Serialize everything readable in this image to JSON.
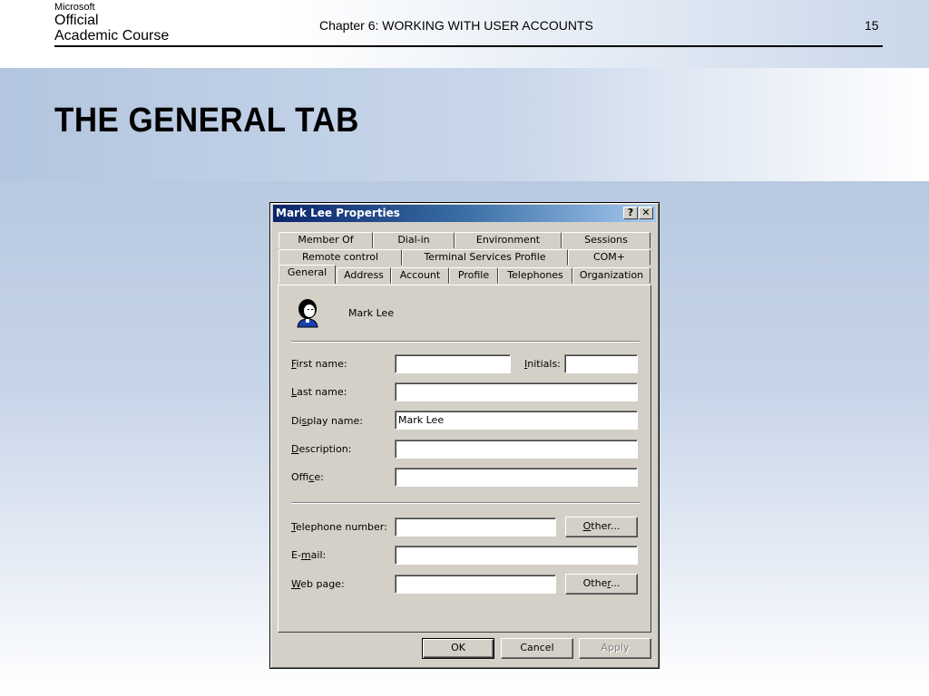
{
  "slide": {
    "logo": {
      "line1": "Microsoft",
      "line2": "Official",
      "line3": "Academic Course"
    },
    "chapter": "Chapter 6: WORKING WITH USER ACCOUNTS",
    "page_number": "15",
    "title": "THE GENERAL TAB"
  },
  "dialog": {
    "title": "Mark Lee Properties",
    "help_button": "?",
    "close_button": "✕",
    "tabs_row1": [
      "Member Of",
      "Dial-in",
      "Environment",
      "Sessions"
    ],
    "tabs_row2": [
      "Remote control",
      "Terminal Services Profile",
      "COM+"
    ],
    "tabs_row3": [
      "General",
      "Address",
      "Account",
      "Profile",
      "Telephones",
      "Organization"
    ],
    "active_tab": "General",
    "user_icon": "user-icon",
    "user_name": "Mark Lee",
    "fields": {
      "first_name": {
        "label": "First name:",
        "value": ""
      },
      "initials": {
        "label": "Initials:",
        "value": ""
      },
      "last_name": {
        "label": "Last name:",
        "value": ""
      },
      "display_name": {
        "label": "Display name:",
        "value": "Mark Lee"
      },
      "description": {
        "label": "Description:",
        "value": ""
      },
      "office": {
        "label": "Office:",
        "value": ""
      },
      "telephone": {
        "label": "Telephone number:",
        "value": ""
      },
      "email": {
        "label": "E-mail:",
        "value": ""
      },
      "web_page": {
        "label": "Web page:",
        "value": ""
      }
    },
    "other_button_1": "Other...",
    "other_button_2": "Other...",
    "ok_button": "OK",
    "cancel_button": "Cancel",
    "apply_button": "Apply"
  }
}
